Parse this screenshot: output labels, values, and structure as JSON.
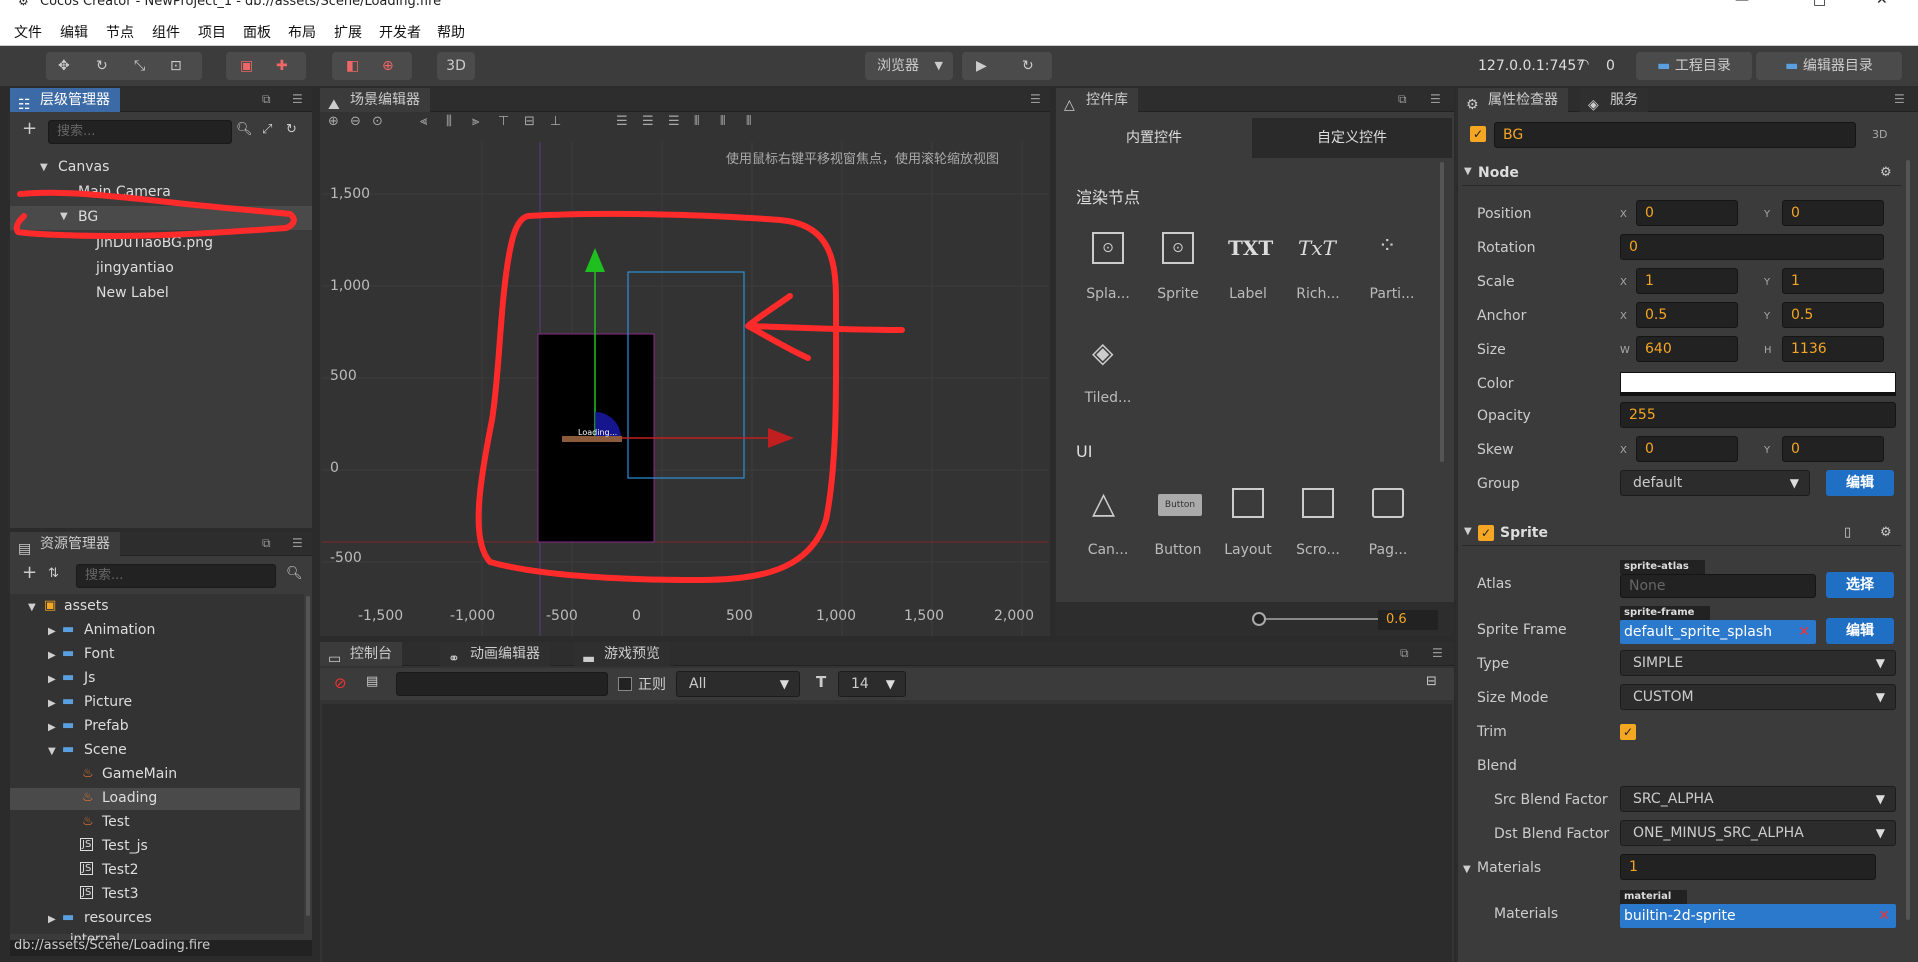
{
  "window": {
    "title": "Cocos Creator - NewProject_1 - db://assets/Scene/Loading.fire",
    "minimize": "—",
    "maximize": "□",
    "close": "✕"
  },
  "menu": [
    "文件",
    "编辑",
    "节点",
    "组件",
    "项目",
    "面板",
    "布局",
    "扩展",
    "开发者",
    "帮助"
  ],
  "toolbar": {
    "mode_3d": "3D",
    "browser": "浏览器",
    "ip": "127.0.0.1:7457",
    "connections": "0",
    "project_dir": "工程目录",
    "editor_dir": "编辑器目录"
  },
  "hierarchy": {
    "tab": "层级管理器",
    "search_placeholder": "搜索...",
    "items": [
      "Canvas",
      "Main Camera",
      "BG",
      "JinDuTiaoBG.png",
      "jingyantiao",
      "New Label"
    ]
  },
  "assets": {
    "tab": "资源管理器",
    "search_placeholder": "搜索...",
    "items": [
      "assets",
      "Animation",
      "Font",
      "Js",
      "Picture",
      "Prefab",
      "Scene",
      "GameMain",
      "Loading",
      "Test",
      "Test_js",
      "Test2",
      "Test3",
      "resources",
      "internal"
    ],
    "status_path": "db://assets/Scene/Loading.fire"
  },
  "scene": {
    "tab": "场景编辑器",
    "hint": "使用鼠标右键平移视窗焦点，使用滚轮缩放视图",
    "y_ticks": [
      "1,500",
      "1,000",
      "500",
      "0",
      "-500"
    ],
    "x_ticks": [
      "-1,500",
      "-1,000",
      "-500",
      "0",
      "500",
      "1,000",
      "1,500",
      "2,000"
    ],
    "label_text": "Loading..."
  },
  "controls": {
    "tab": "控件库",
    "builtin_tab": "内置控件",
    "custom_tab": "自定义控件",
    "render_section": "渲染节点",
    "render_items": [
      {
        "icon": "TXT",
        "label": "Spla..."
      },
      {
        "icon": "",
        "label": "Sprite"
      },
      {
        "icon": "TXT",
        "label": "Label"
      },
      {
        "icon": "TxT",
        "label": "Rich..."
      },
      {
        "icon": "",
        "label": "Parti..."
      },
      {
        "icon": "",
        "label": "Tiled..."
      }
    ],
    "ui_section": "UI",
    "ui_items": [
      {
        "label": "Can..."
      },
      {
        "label": "Button",
        "icon_text": "Button"
      },
      {
        "label": "Layout"
      },
      {
        "label": "Scro..."
      },
      {
        "label": "Pag..."
      }
    ],
    "zoom_value": "0.6"
  },
  "console": {
    "tabs": [
      "控制台",
      "动画编辑器",
      "游戏预览"
    ],
    "regex_label": "正则",
    "level_select": "All",
    "font_size": "14"
  },
  "inspector": {
    "tabs": [
      "属性检查器",
      "服务"
    ],
    "node_name": "BG",
    "badge_3d": "3D",
    "node_section": "Node",
    "position": {
      "label": "Position",
      "x": "0",
      "y": "0"
    },
    "rotation": {
      "label": "Rotation",
      "value": "0"
    },
    "scale": {
      "label": "Scale",
      "x": "1",
      "y": "1"
    },
    "anchor": {
      "label": "Anchor",
      "x": "0.5",
      "y": "0.5"
    },
    "size": {
      "label": "Size",
      "w": "640",
      "h": "1136"
    },
    "color": {
      "label": "Color",
      "value": "#ffffff"
    },
    "opacity": {
      "label": "Opacity",
      "value": "255"
    },
    "skew": {
      "label": "Skew",
      "x": "0",
      "y": "0"
    },
    "group": {
      "label": "Group",
      "value": "default",
      "edit": "编辑"
    },
    "sprite_section": "Sprite",
    "atlas": {
      "label": "Atlas",
      "tag": "sprite-atlas",
      "value": "None",
      "select": "选择"
    },
    "sprite_frame": {
      "label": "Sprite Frame",
      "tag": "sprite-frame",
      "value": "default_sprite_splash",
      "edit": "编辑"
    },
    "type": {
      "label": "Type",
      "value": "SIMPLE"
    },
    "size_mode": {
      "label": "Size Mode",
      "value": "CUSTOM"
    },
    "trim": {
      "label": "Trim"
    },
    "blend": {
      "label": "Blend"
    },
    "src_blend": {
      "label": "Src Blend Factor",
      "value": "SRC_ALPHA"
    },
    "dst_blend": {
      "label": "Dst Blend Factor",
      "value": "ONE_MINUS_SRC_ALPHA"
    },
    "materials_count": {
      "label": "Materials",
      "value": "1"
    },
    "materials": {
      "label": "Materials",
      "tag": "material",
      "value": "builtin-2d-sprite"
    },
    "xy": {
      "x": "X",
      "y": "Y",
      "w": "W",
      "h": "H"
    }
  },
  "colors": {
    "accent": "#1f6fc5",
    "field_value": "#f5a623",
    "annotation": "#ff2a2a"
  }
}
